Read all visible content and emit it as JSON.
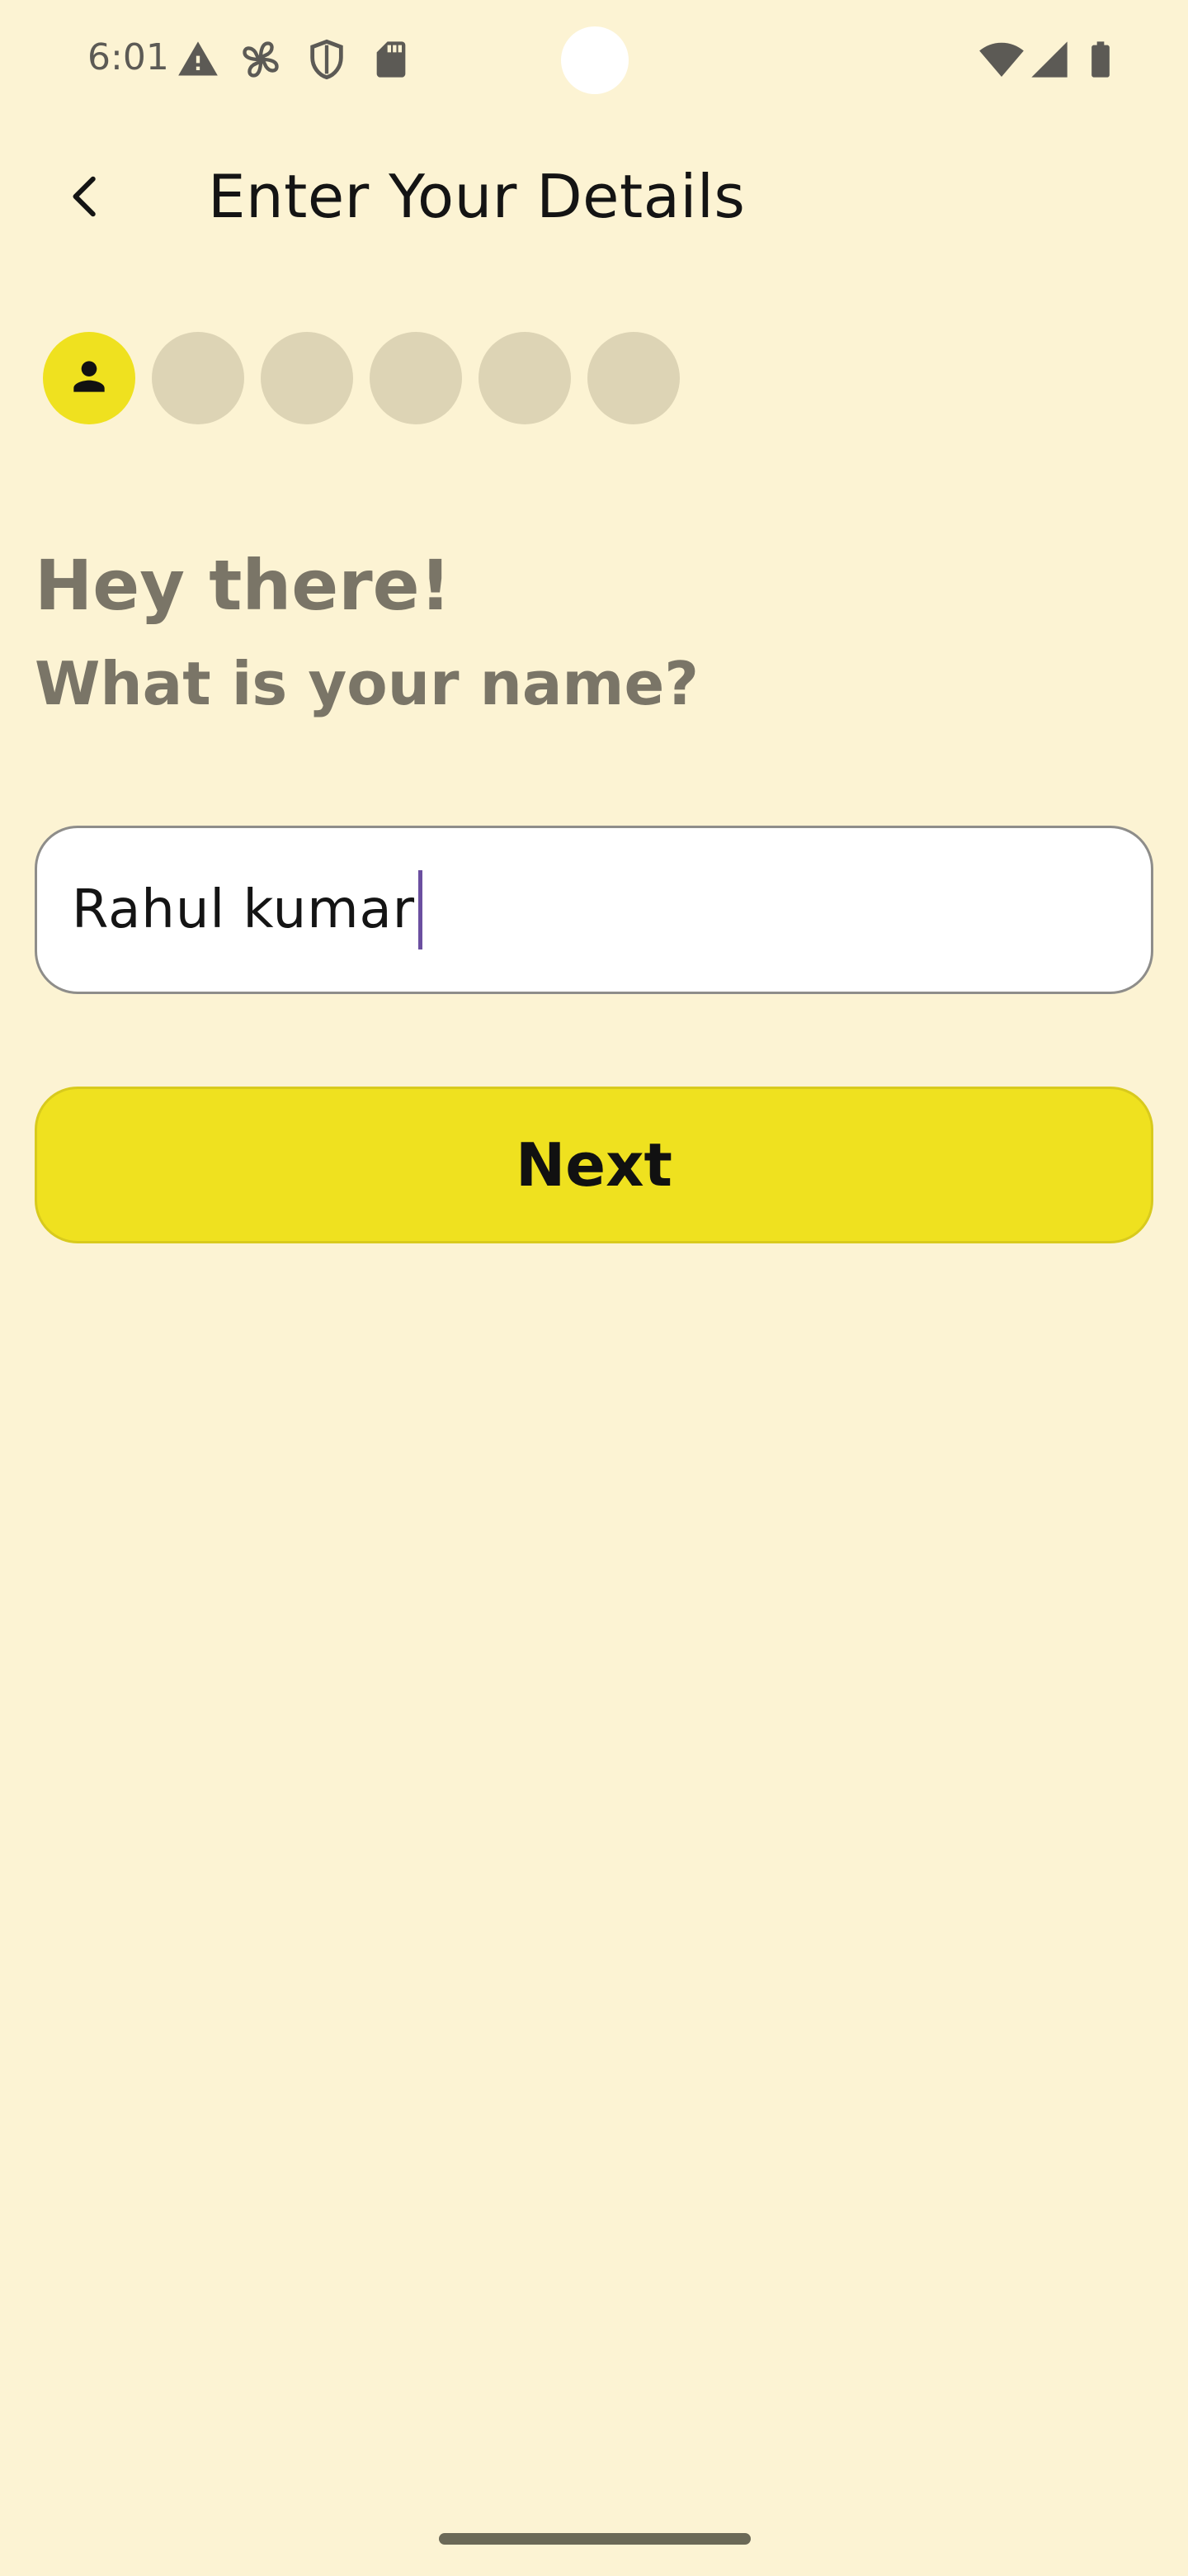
{
  "status_bar": {
    "time": "6:01",
    "left_icons": [
      "warning-icon",
      "fan-icon",
      "shield-icon",
      "sd-card-icon"
    ],
    "right_icons": [
      "wifi-icon",
      "signal-icon",
      "battery-icon"
    ]
  },
  "app_bar": {
    "back_icon": "arrow-back-icon",
    "title": "Enter Your Details"
  },
  "steps": {
    "total": 6,
    "current": 1,
    "current_icon": "person-icon"
  },
  "content": {
    "greeting": "Hey there!",
    "question": "What is your name?"
  },
  "name_input": {
    "value": "Rahul kumar"
  },
  "next_button": {
    "label": "Next"
  },
  "colors": {
    "background": "#fcf3d3",
    "accent": "#efe11f",
    "step_inactive": "#ddd4b5",
    "heading_text": "#7a7567",
    "caret": "#6b4fa0"
  }
}
